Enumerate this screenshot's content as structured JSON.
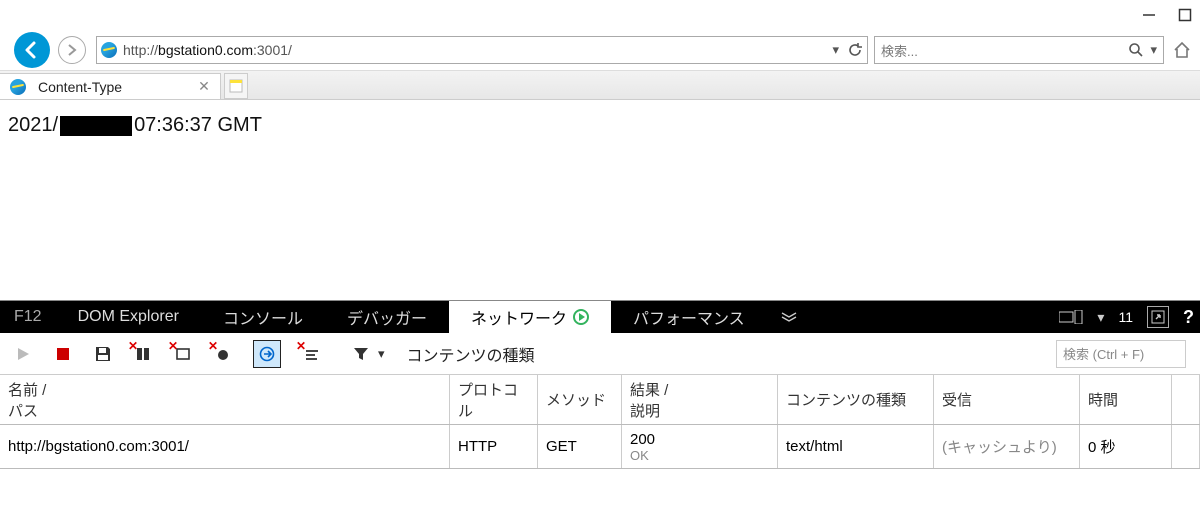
{
  "address": {
    "scheme": "http://",
    "host": "bgstation0.com",
    "port": ":3001/"
  },
  "search": {
    "placeholder": "検索..."
  },
  "tab": {
    "title": "Content-Type"
  },
  "page": {
    "year": "2021",
    "time": "07:36:37 GMT"
  },
  "devtools": {
    "tabs": {
      "f12": "F12",
      "dom": "DOM Explorer",
      "console": "コンソール",
      "debugger": "デバッガー",
      "network": "ネットワーク",
      "performance": "パフォーマンス"
    },
    "counter": "11",
    "help": "?",
    "toolbar": {
      "content_types": "コンテンツの種類"
    },
    "search_placeholder": "検索 (Ctrl + F)",
    "columns": {
      "name_l1": "名前 /",
      "name_l2": "パス",
      "protocol": "プロトコル",
      "method": "メソッド",
      "result_l1": "結果 /",
      "result_l2": "説明",
      "content_type": "コンテンツの種類",
      "received": "受信",
      "time": "時間"
    },
    "row": {
      "name": "http://bgstation0.com:3001/",
      "protocol": "HTTP",
      "method": "GET",
      "status_code": "200",
      "status_text": "OK",
      "content_type": "text/html",
      "received": "(キャッシュより)",
      "time": "0 秒"
    }
  }
}
